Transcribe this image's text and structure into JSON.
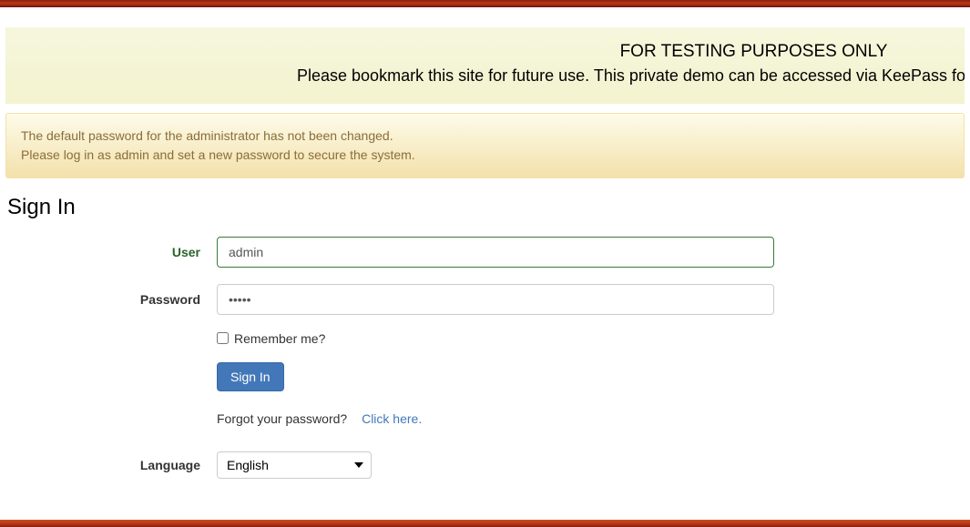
{
  "banners": {
    "testing": {
      "line1": "FOR TESTING PURPOSES ONLY",
      "line2": "Please bookmark this site for future use. This private demo can be accessed via KeePass for Pleasanter"
    },
    "warning": {
      "line1": "The default password for the administrator has not been changed.",
      "line2": "Please log in as admin and set a new password to secure the system."
    }
  },
  "page": {
    "title": "Sign In"
  },
  "form": {
    "user_label": "User",
    "user_value": "admin",
    "password_label": "Password",
    "password_value": "•••••",
    "remember_label": "Remember me?",
    "signin_label": "Sign In",
    "forgot_text": "Forgot your password?",
    "forgot_link": "Click here.",
    "language_label": "Language",
    "language_selected": "English"
  }
}
